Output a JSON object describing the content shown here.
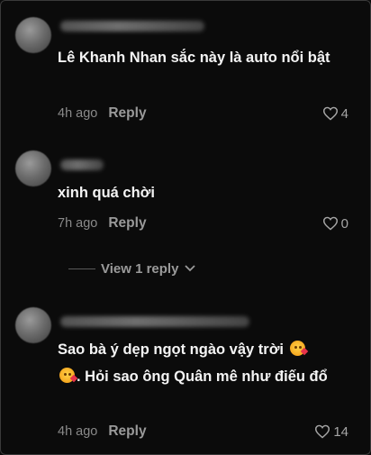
{
  "comments": [
    {
      "text": "Lê Khanh Nhan sắc này là auto nổi bật",
      "time": "4h ago",
      "reply_label": "Reply",
      "likes": "4"
    },
    {
      "text": "xinh quá chời",
      "time": "7h ago",
      "reply_label": "Reply",
      "likes": "0",
      "view_replies": "View 1 reply"
    },
    {
      "text_part1": "Sao bà ý dẹp ngọt ngào vậy trời",
      "text_part2": ". Hỏi sao ông Quân mê như điếu đổ",
      "time": "4h ago",
      "reply_label": "Reply",
      "likes": "14"
    }
  ],
  "icons": {
    "like": "heart-outline-icon",
    "expand": "chevron-down-icon",
    "emoji": "face-blowing-kiss-emoji"
  }
}
